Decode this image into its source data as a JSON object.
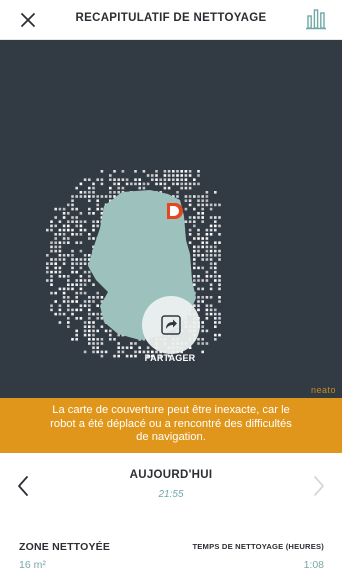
{
  "header": {
    "title": "RECAPITULATIF DE NETTOYAGE",
    "close_icon": "close-icon",
    "stats_icon": "bar-chart-icon"
  },
  "map": {
    "share_label": "PARTAGER",
    "share_icon": "share-icon",
    "base_marker_icon": "charging-base-icon",
    "brand": "neato",
    "colors": {
      "background": "#323a43",
      "cleaned_area": "#9dc1bd",
      "obstacle": "#ffffff",
      "base_marker": "#e5461f"
    }
  },
  "warning": {
    "line1": "La carte de couverture peut être inexacte, car le",
    "line2": "robot a été déplacé ou a rencontré des difficultés",
    "line3": "de navigation.",
    "color": "#e0961b"
  },
  "navigation": {
    "date_label": "AUJOURD'HUI",
    "time": "21:55",
    "prev_icon": "chevron-left-icon",
    "next_icon": "chevron-right-icon"
  },
  "stats": {
    "zone_title": "ZONE NETTOYÉE",
    "zone_value": "16 m²",
    "time_title": "TEMPS DE NETTOYAGE (HEURES)",
    "time_value": "1:08"
  }
}
